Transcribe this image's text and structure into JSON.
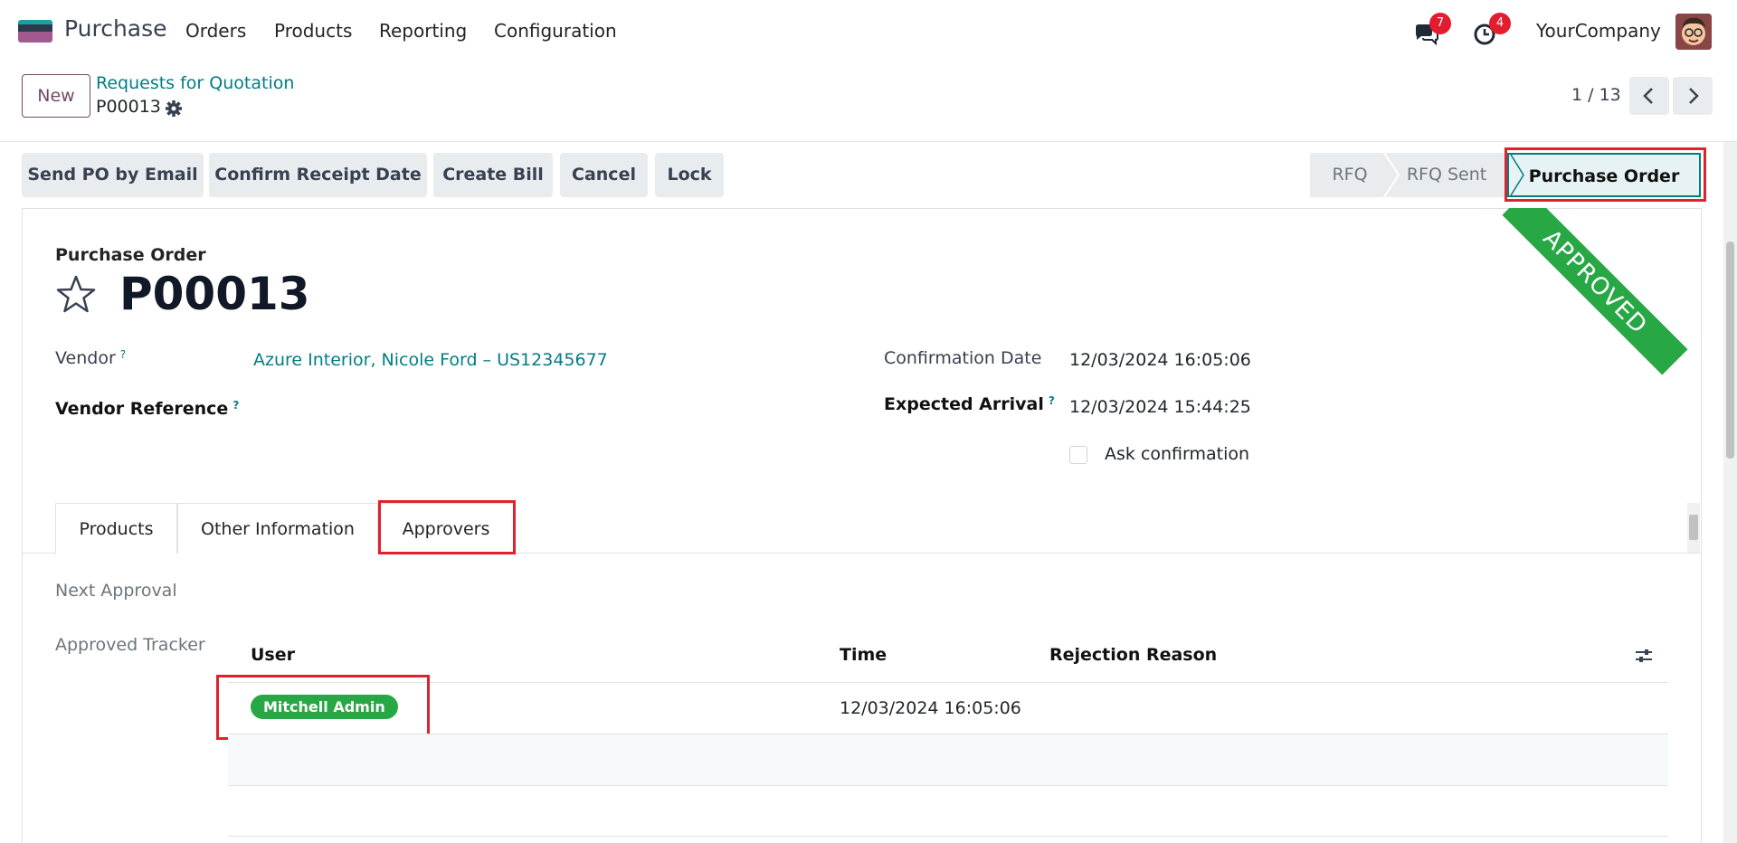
{
  "navbar": {
    "app_name": "Purchase",
    "menu": [
      "Orders",
      "Products",
      "Reporting",
      "Configuration"
    ],
    "messages_count": "7",
    "activities_count": "4",
    "company": "YourCompany"
  },
  "control_panel": {
    "new_label": "New",
    "breadcrumb_parent": "Requests for Quotation",
    "breadcrumb_current": "P00013",
    "pager": "1 / 13"
  },
  "statusbar": {
    "buttons": [
      "Send PO by Email",
      "Confirm Receipt Date",
      "Create Bill",
      "Cancel",
      "Lock"
    ],
    "stages": [
      "RFQ",
      "RFQ Sent",
      "Purchase Order"
    ],
    "active_stage": "Purchase Order"
  },
  "form": {
    "ribbon": "APPROVED",
    "title_label": "Purchase Order",
    "name": "P00013",
    "vendor_label": "Vendor",
    "vendor_value": "Azure Interior, Nicole Ford – US12345677",
    "vendor_ref_label": "Vendor Reference",
    "confirmation_date_label": "Confirmation Date",
    "confirmation_date_value": "12/03/2024 16:05:06",
    "expected_arrival_label": "Expected Arrival",
    "expected_arrival_value": "12/03/2024 15:44:25",
    "ask_confirmation_label": "Ask confirmation",
    "help_mark": "?"
  },
  "tabs": [
    "Products",
    "Other Information",
    "Approvers"
  ],
  "active_tab": "Approvers",
  "approvers": {
    "next_approval_label": "Next Approval",
    "approved_tracker_label": "Approved Tracker",
    "columns": [
      "User",
      "Time",
      "Rejection Reason"
    ],
    "rows": [
      {
        "user": "Mitchell Admin",
        "time": "12/03/2024 16:05:06",
        "reason": ""
      }
    ]
  },
  "colors": {
    "brand": "#714b67",
    "link": "#017e84",
    "approved": "#28a745",
    "highlight": "#e0222e"
  }
}
